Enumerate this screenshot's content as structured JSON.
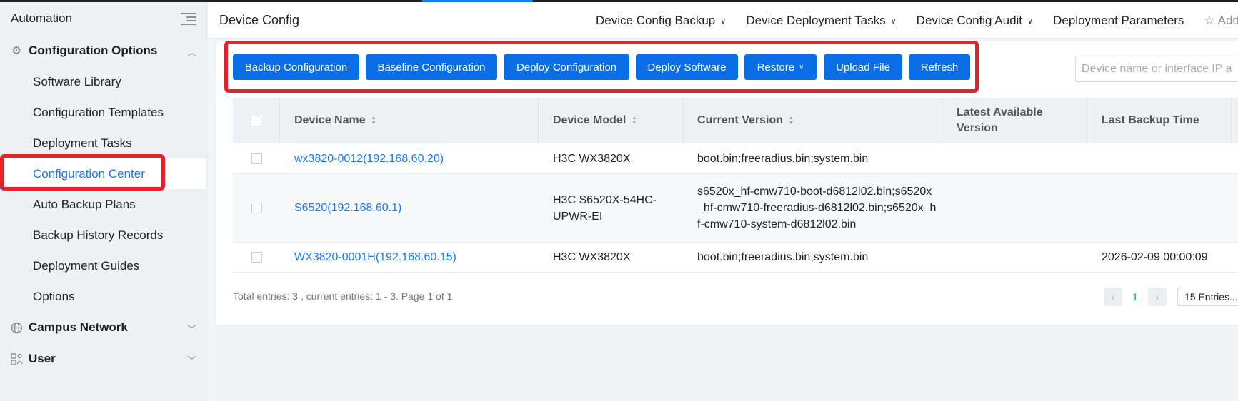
{
  "sidebar": {
    "title": "Automation",
    "groups": [
      {
        "label": "Configuration Options",
        "icon": "gear-icon",
        "expanded": true
      },
      {
        "label": "Campus Network",
        "icon": "globe-icon",
        "expanded": false
      },
      {
        "label": "User",
        "icon": "user-group-icon",
        "expanded": false
      }
    ],
    "items": [
      {
        "label": "Software Library"
      },
      {
        "label": "Configuration Templates"
      },
      {
        "label": "Deployment Tasks"
      },
      {
        "label": "Configuration Center"
      },
      {
        "label": "Auto Backup Plans"
      },
      {
        "label": "Backup History Records"
      },
      {
        "label": "Deployment Guides"
      },
      {
        "label": "Options"
      }
    ],
    "active_item": "Configuration Center"
  },
  "header": {
    "title": "Device Config",
    "nav": [
      {
        "label": "Device Config Backup"
      },
      {
        "label": "Device Deployment Tasks"
      },
      {
        "label": "Device Config Audit"
      },
      {
        "label": "Deployment Parameters"
      },
      {
        "label": "Add"
      }
    ]
  },
  "toolbar": {
    "buttons": [
      {
        "label": "Backup Configuration"
      },
      {
        "label": "Baseline Configuration"
      },
      {
        "label": "Deploy Configuration"
      },
      {
        "label": "Deploy Software"
      },
      {
        "label": "Restore"
      },
      {
        "label": "Upload File"
      },
      {
        "label": "Refresh"
      }
    ],
    "search_placeholder": "Device name or interface IP a"
  },
  "table": {
    "columns": [
      {
        "label": "Device Name"
      },
      {
        "label": "Device Model"
      },
      {
        "label": "Current Version"
      },
      {
        "label": "Latest Available Version"
      },
      {
        "label": "Last Backup Time"
      }
    ],
    "rows": [
      {
        "device_name": "wx3820-0012(192.168.60.20)",
        "device_model": "H3C WX3820X",
        "current_version": "boot.bin;freeradius.bin;system.bin",
        "latest_version": "",
        "last_backup": ""
      },
      {
        "device_name": "S6520(192.168.60.1)",
        "device_model": "H3C S6520X-54HC-UPWR-EI",
        "current_version": "s6520x_hf-cmw710-boot-d6812l02.bin;s6520x_hf-cmw710-freeradius-d6812l02.bin;s6520x_hf-cmw710-system-d6812l02.bin",
        "latest_version": "",
        "last_backup": ""
      },
      {
        "device_name": "WX3820-0001H(192.168.60.15)",
        "device_model": "H3C WX3820X",
        "current_version": "boot.bin;freeradius.bin;system.bin",
        "latest_version": "",
        "last_backup": "2026-02-09 00:00:09"
      }
    ]
  },
  "pagination": {
    "summary": "Total entries: 3 , current entries: 1 - 3. Page 1 of 1",
    "current_page": "1",
    "page_size": "15 Entries..."
  },
  "colors": {
    "accent": "#1677ff",
    "button": "#0a6ee6",
    "highlight": "#e8202a"
  }
}
